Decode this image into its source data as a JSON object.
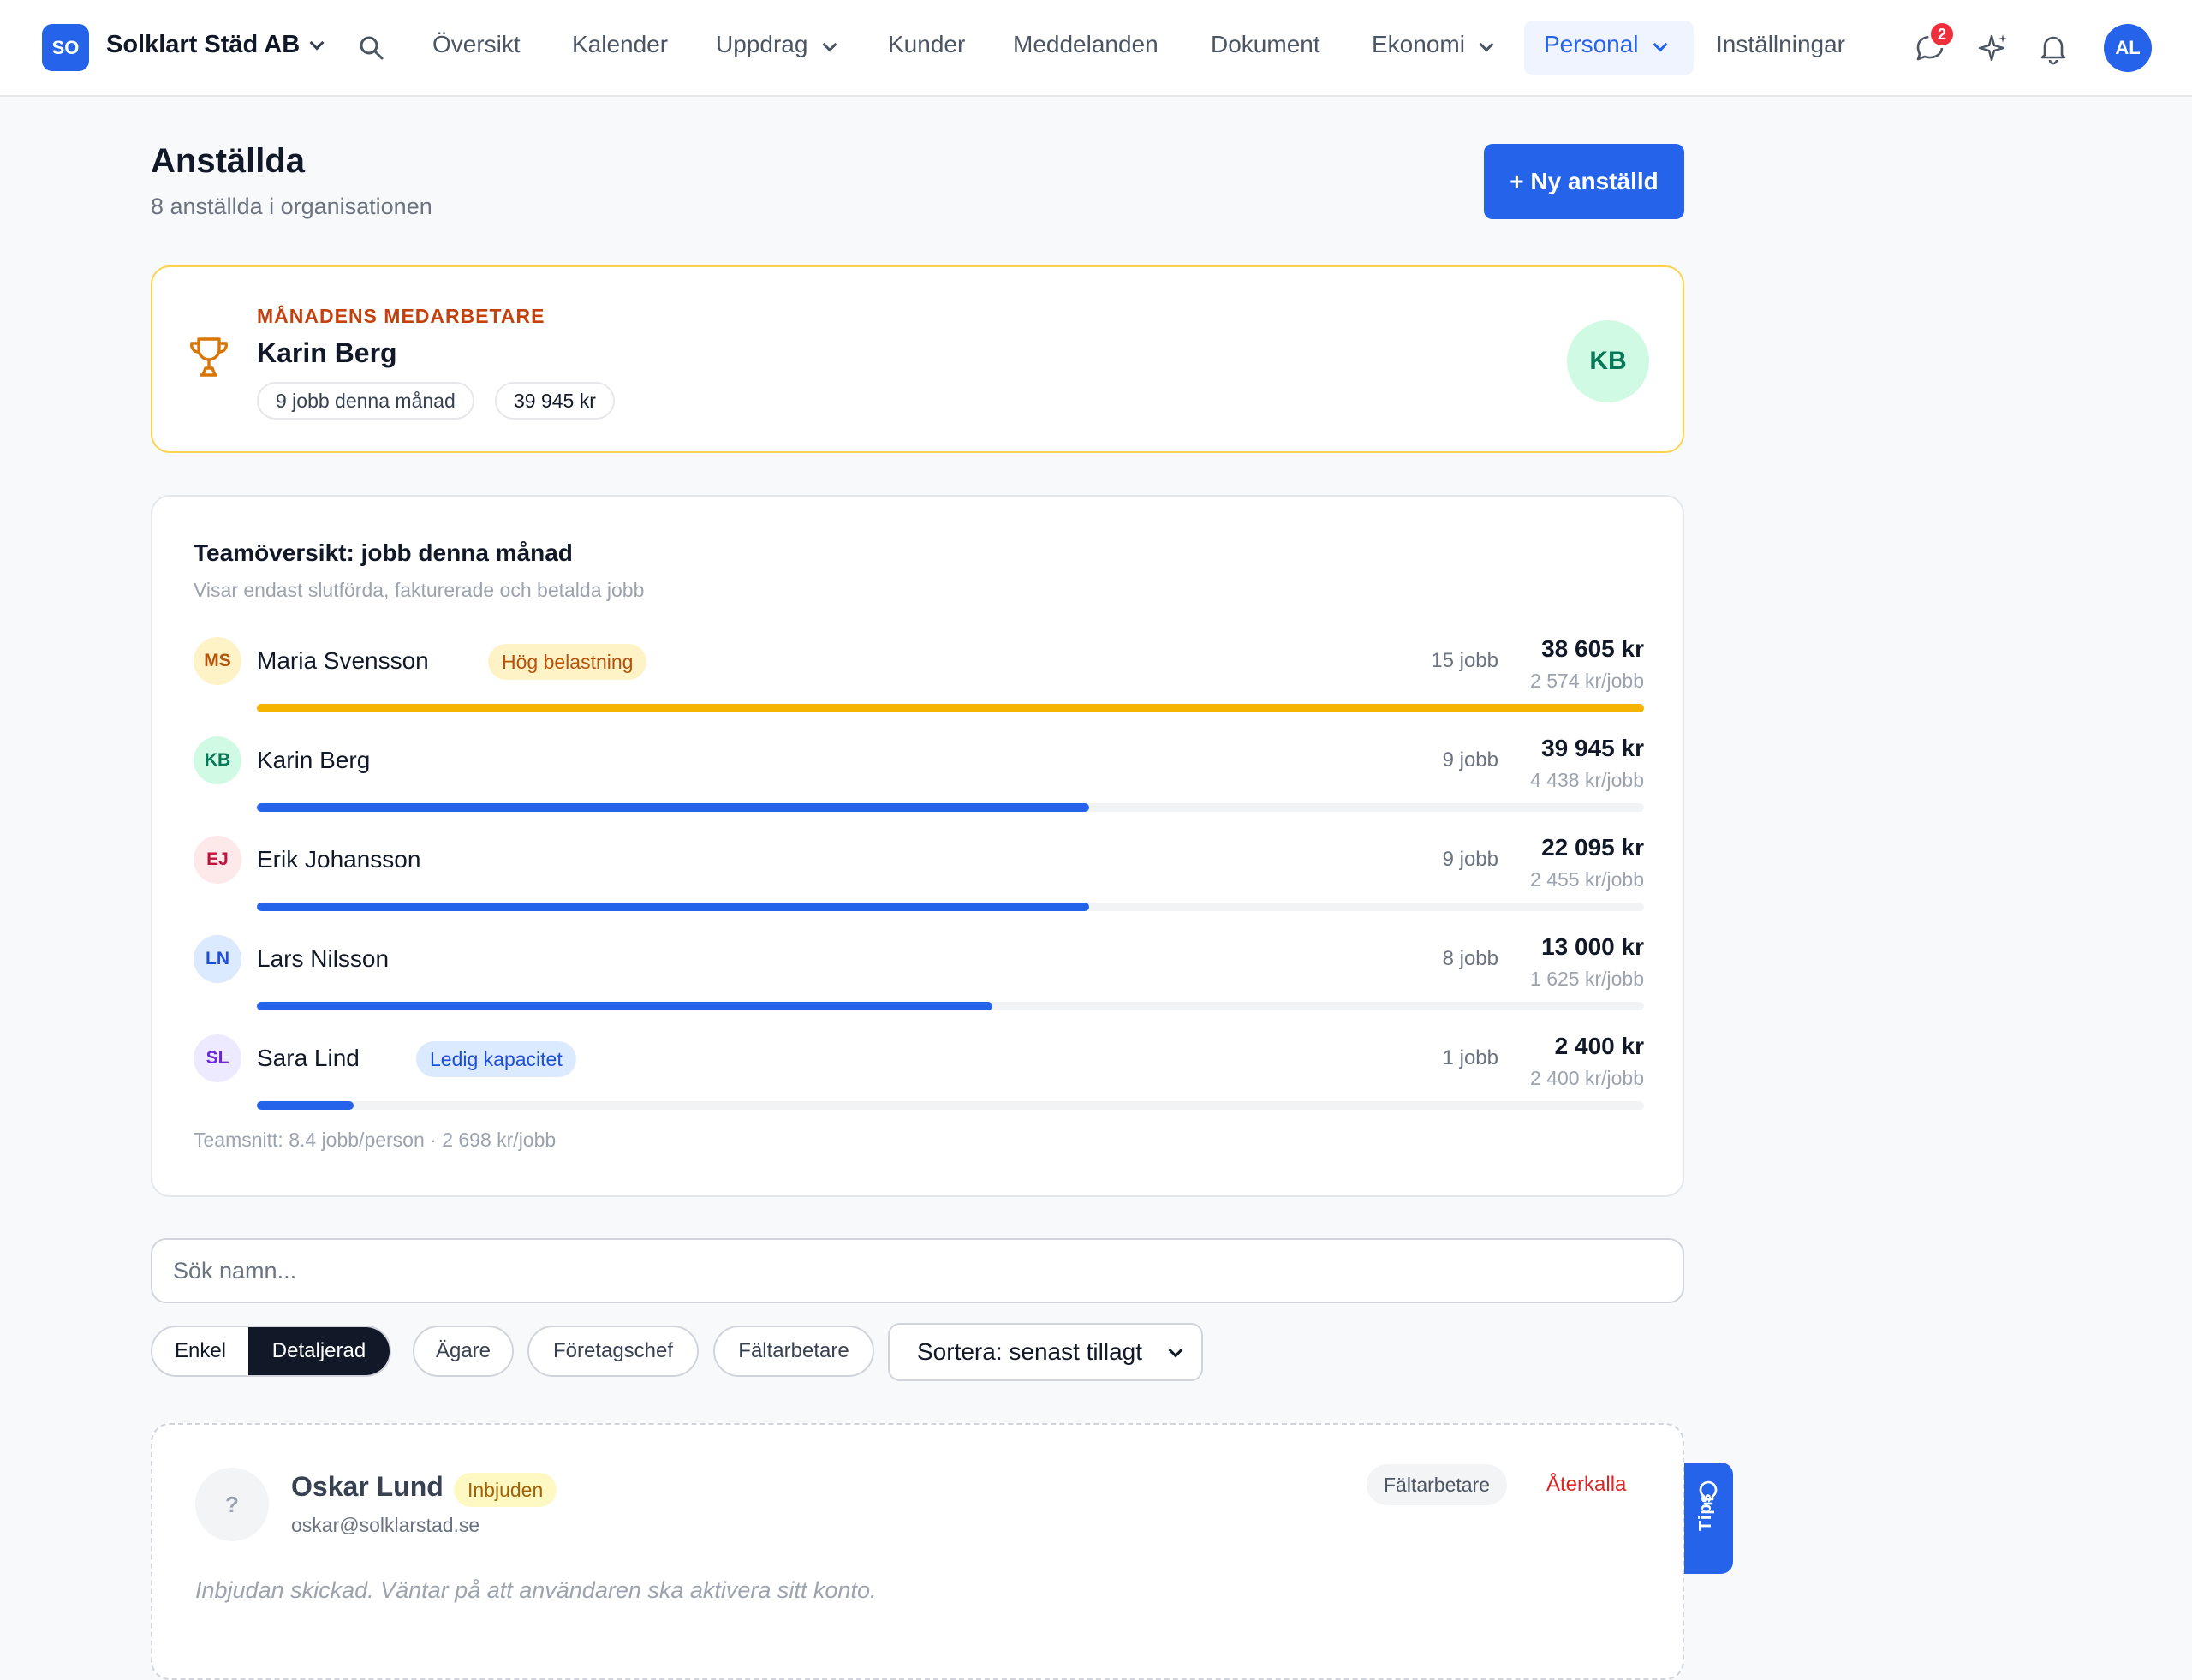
{
  "topbar": {
    "org_badge": "SO",
    "org_name": "Solklart Städ AB",
    "nav": [
      "Översikt",
      "Kalender",
      "Uppdrag",
      "Kunder",
      "Meddelanden",
      "Dokument",
      "Ekonomi",
      "Personal",
      "Inställningar"
    ],
    "active_nav": "Personal",
    "message_count": "2",
    "user_initials": "AL"
  },
  "header": {
    "title": "Anställda",
    "subtitle": "8 anställda i organisationen",
    "new_button": "+ Ny anställd"
  },
  "employee_of_month": {
    "kicker": "MÅNADENS MEDARBETARE",
    "name": "Karin Berg",
    "jobs": "9 jobb denna månad",
    "revenue": "39 945 kr",
    "initials": "KB"
  },
  "team": {
    "title": "Teamöversikt: jobb denna månad",
    "subtitle": "Visar endast slutförda, fakturerade och betalda jobb",
    "rows": [
      {
        "initials": "MS",
        "name": "Maria Svensson",
        "tag": "Hög belastning",
        "jobs": "15 jobb",
        "total": "38 605 kr",
        "per_job": "2 574 kr/jobb",
        "share": 1.0
      },
      {
        "initials": "KB",
        "name": "Karin Berg",
        "tag": "",
        "jobs": "9 jobb",
        "total": "39 945 kr",
        "per_job": "4 438 kr/jobb",
        "share": 0.6
      },
      {
        "initials": "EJ",
        "name": "Erik Johansson",
        "tag": "",
        "jobs": "9 jobb",
        "total": "22 095 kr",
        "per_job": "2 455 kr/jobb",
        "share": 0.6
      },
      {
        "initials": "LN",
        "name": "Lars Nilsson",
        "tag": "",
        "jobs": "8 jobb",
        "total": "13 000 kr",
        "per_job": "1 625 kr/jobb",
        "share": 0.53
      },
      {
        "initials": "SL",
        "name": "Sara Lind",
        "tag": "Ledig kapacitet",
        "jobs": "1 jobb",
        "total": "2 400 kr",
        "per_job": "2 400 kr/jobb",
        "share": 0.07
      }
    ],
    "footer": "Teamsnitt: 8.4 jobb/person · 2 698 kr/jobb"
  },
  "filters": {
    "search_placeholder": "Sök namn...",
    "view_simple": "Enkel",
    "view_detailed": "Detaljerad",
    "roles": [
      "Ägare",
      "Företagschef",
      "Fältarbetare"
    ],
    "sort": "Sortera: senast tillagt"
  },
  "invited": {
    "avatar": "?",
    "name": "Oskar Lund",
    "badge": "Inbjuden",
    "email": "oskar@solklarstad.se",
    "role": "Fältarbetare",
    "revoke": "Återkalla",
    "note": "Inbjudan skickad. Väntar på att användaren ska aktivera sitt konto."
  },
  "tips_label": "Tips",
  "colors": {
    "accent": "#2563eb",
    "warning": "#f5b400",
    "danger": "#dc2626"
  },
  "icons": [
    "search-icon",
    "chat-icon",
    "sparkle-icon",
    "bell-icon",
    "trophy-icon",
    "lightbulb-icon",
    "chevron-down-icon"
  ]
}
